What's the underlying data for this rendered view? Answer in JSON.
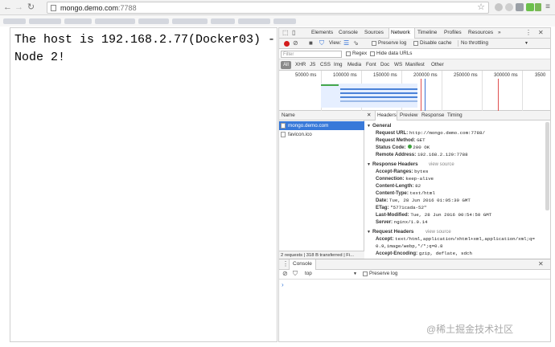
{
  "browser": {
    "url_host": "mongo.demo.com",
    "url_port": ":7788",
    "back_icon": "arrow-left",
    "forward_icon": "arrow-right",
    "reload_icon": "reload",
    "star_icon": "star",
    "menu_icon": "hamburger"
  },
  "page": {
    "text": "The host is 192.168.2.77(Docker03) -\nNode 2!"
  },
  "devtools": {
    "tabs": [
      "Elements",
      "Console",
      "Sources",
      "Network",
      "Timeline",
      "Profiles",
      "Resources",
      "»"
    ],
    "active_tab": "Network",
    "network_toolbar": {
      "view_label": "View:",
      "preserve_log": "Preserve log",
      "disable_cache": "Disable cache",
      "throttling": "No throttling"
    },
    "filter": {
      "placeholder": "Filter",
      "regex": "Regex",
      "hide_data_urls": "Hide data URLs"
    },
    "types": [
      "All",
      "XHR",
      "JS",
      "CSS",
      "Img",
      "Media",
      "Font",
      "Doc",
      "WS",
      "Manifest",
      "Other"
    ],
    "overview_ticks": [
      "50000 ms",
      "100000 ms",
      "150000 ms",
      "200000 ms",
      "250000 ms",
      "300000 ms",
      "3500"
    ],
    "list": {
      "header": "Name",
      "rows": [
        "mongo.demo.com",
        "favicon.ico"
      ],
      "status": "2 requests | 318 B transferred | Fi..."
    },
    "detail_tabs": [
      "Headers",
      "Preview",
      "Response",
      "Timing"
    ],
    "general": {
      "title": "General",
      "request_url_k": "Request URL:",
      "request_url_v": "http://mongo.demo.com:7788/",
      "request_method_k": "Request Method:",
      "request_method_v": "GET",
      "status_code_k": "Status Code:",
      "status_code_v": "200 OK",
      "remote_address_k": "Remote Address:",
      "remote_address_v": "192.168.2.129:7788"
    },
    "response_headers": {
      "title": "Response Headers",
      "view_source": "view source",
      "items": [
        {
          "k": "Accept-Ranges:",
          "v": "bytes"
        },
        {
          "k": "Connection:",
          "v": "keep-alive"
        },
        {
          "k": "Content-Length:",
          "v": "82"
        },
        {
          "k": "Content-Type:",
          "v": "text/html"
        },
        {
          "k": "Date:",
          "v": "Tue, 28 Jun 2016 01:05:30 GMT"
        },
        {
          "k": "ETag:",
          "v": "\"5771cada-52\""
        },
        {
          "k": "Last-Modified:",
          "v": "Tue, 28 Jun 2016 00:54:50 GMT"
        },
        {
          "k": "Server:",
          "v": "nginx/1.9.14"
        }
      ]
    },
    "request_headers": {
      "title": "Request Headers",
      "view_source": "view source",
      "accept_k": "Accept:",
      "accept_v1": "text/html,application/xhtml+xml,application/xml;q=",
      "accept_v2": "0.9,image/webp,*/*;q=0.8",
      "encoding_k": "Accept-Encoding:",
      "encoding_v": "gzip, deflate, sdch"
    },
    "console": {
      "tab": "Console",
      "context": "top",
      "preserve_log": "Preserve log",
      "prompt": "›"
    }
  },
  "watermark": "@稀土掘金技术社区"
}
